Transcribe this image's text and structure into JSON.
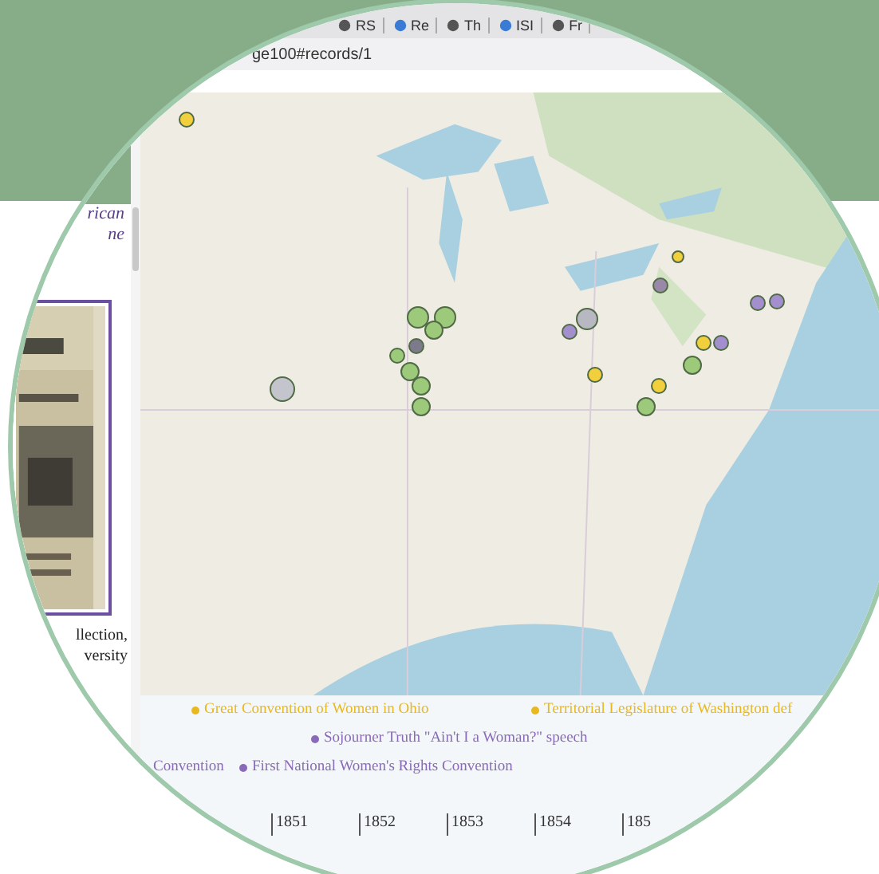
{
  "browser_tabs": [
    {
      "label": "RS"
    },
    {
      "label": "Re"
    },
    {
      "label": "Th"
    },
    {
      "label": "ISI"
    },
    {
      "label": "Fr"
    }
  ],
  "address_bar": {
    "url": "ge100#records/1"
  },
  "side_panel": {
    "heading_lines": [
      "rican",
      "ne"
    ],
    "caption_lines": [
      "llection,",
      "versity"
    ]
  },
  "map": {
    "markers": [
      {
        "color": "#f2cf3c"
      },
      {
        "color": "#9cc97a"
      },
      {
        "color": "#9cc97a"
      },
      {
        "color": "#9cc97a"
      },
      {
        "color": "#9cc97a"
      },
      {
        "color": "#7d7a8c"
      },
      {
        "color": "#9cc97a"
      },
      {
        "color": "#9cc97a"
      },
      {
        "color": "#9cc97a"
      },
      {
        "color": "#c4c4cc"
      },
      {
        "color": "#a48fce"
      },
      {
        "color": "#b8b8c2"
      },
      {
        "color": "#9a88a8"
      },
      {
        "color": "#f2cf3c"
      },
      {
        "color": "#a48fce"
      },
      {
        "color": "#a48fce"
      },
      {
        "color": "#f2cf3c"
      },
      {
        "color": "#a48fce"
      },
      {
        "color": "#9cc97a"
      },
      {
        "color": "#f2cf3c"
      },
      {
        "color": "#f2cf3c"
      },
      {
        "color": "#9cc97a"
      }
    ]
  },
  "timeline": {
    "events": [
      {
        "label": "Great Convention of Women in Ohio",
        "color": "#e8b820",
        "dot": true
      },
      {
        "label": "Territorial Legislature of Washington def",
        "color": "#e8b820",
        "dot": true
      },
      {
        "label": "Sojourner Truth \"Ain't I a Woman?\" speech",
        "color": "#8a6ab8",
        "dot": true
      },
      {
        "label": "Convention",
        "color": "#8a6ab8",
        "dot": false
      },
      {
        "label": "First National Women's Rights Convention",
        "color": "#8a6ab8",
        "dot": true
      }
    ],
    "years": [
      "1851",
      "1852",
      "1853",
      "1854",
      "185"
    ]
  }
}
